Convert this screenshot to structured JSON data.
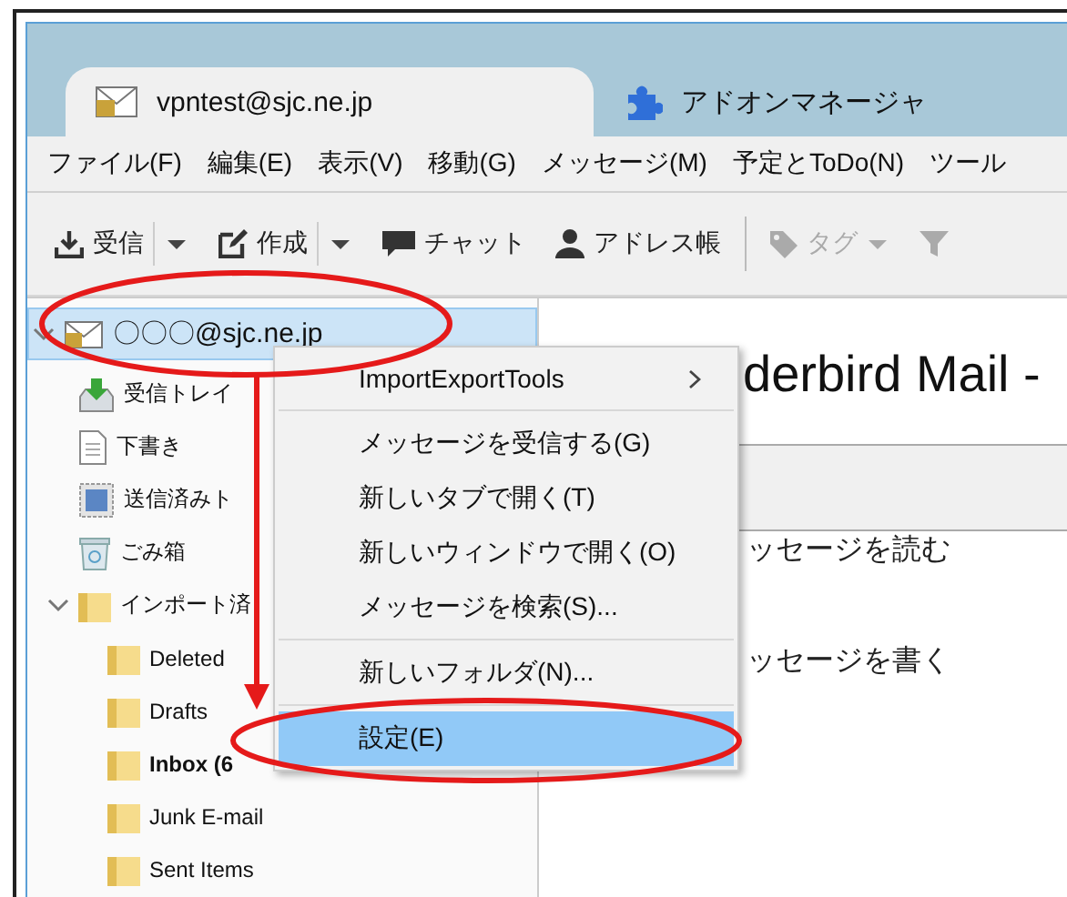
{
  "tabs": [
    {
      "label": "vpntest@sjc.ne.jp",
      "selected": true
    },
    {
      "label": "アドオンマネージャ",
      "selected": false
    }
  ],
  "menubar": [
    "ファイル(F)",
    "編集(E)",
    "表示(V)",
    "移動(G)",
    "メッセージ(M)",
    "予定とToDo(N)",
    "ツール"
  ],
  "toolbar": [
    {
      "kind": "button",
      "label": "受信",
      "dropdown": true,
      "disabled": false
    },
    {
      "kind": "button",
      "label": "作成",
      "dropdown": true,
      "disabled": false
    },
    {
      "kind": "button",
      "label": "チャット",
      "dropdown": false,
      "disabled": false
    },
    {
      "kind": "button",
      "label": "アドレス帳",
      "dropdown": false,
      "disabled": false
    },
    {
      "kind": "separator"
    },
    {
      "kind": "button",
      "label": "タグ",
      "dropdown": true,
      "disabled": true
    },
    {
      "kind": "button",
      "dropdown": false,
      "disabled": true
    }
  ],
  "folders": [
    {
      "name": "〇〇〇@sjc.ne.jp",
      "kind": "account",
      "selected": true,
      "expanded": true,
      "children": [
        {
          "name": "受信トレイ",
          "kind": "inbox",
          "selected": false
        },
        {
          "name": "下書き",
          "kind": "draft",
          "selected": false
        },
        {
          "name": "送信済みト",
          "kind": "sent",
          "selected": false
        },
        {
          "name": "ごみ箱",
          "kind": "trash",
          "selected": false
        },
        {
          "name": "インポート済",
          "kind": "folder",
          "selected": false,
          "expanded": true,
          "children": [
            {
              "name": "Deleted",
              "kind": "folder",
              "selected": false,
              "bold": false
            },
            {
              "name": "Drafts",
              "kind": "folder",
              "selected": false,
              "bold": false
            },
            {
              "name": "Inbox (6",
              "kind": "folder",
              "selected": false,
              "bold": true
            },
            {
              "name": "Junk E-mail",
              "kind": "folder",
              "selected": false,
              "bold": false
            },
            {
              "name": "Sent Items",
              "kind": "folder",
              "selected": false,
              "bold": false
            }
          ]
        }
      ]
    }
  ],
  "content": {
    "heading": "derbird Mail -",
    "links": [
      "ッセージを読む",
      "ッセージを書く"
    ]
  },
  "context_menu": [
    {
      "kind": "item",
      "label": "ImportExportTools",
      "submenu": true,
      "selected": false
    },
    {
      "kind": "separator"
    },
    {
      "kind": "item",
      "label": "メッセージを受信する(G)",
      "submenu": false,
      "selected": false
    },
    {
      "kind": "item",
      "label": "新しいタブで開く(T)",
      "submenu": false,
      "selected": false
    },
    {
      "kind": "item",
      "label": "新しいウィンドウで開く(O)",
      "submenu": false,
      "selected": false
    },
    {
      "kind": "item",
      "label": "メッセージを検索(S)...",
      "submenu": false,
      "selected": false
    },
    {
      "kind": "separator"
    },
    {
      "kind": "item",
      "label": "新しいフォルダ(N)...",
      "submenu": false,
      "selected": false
    },
    {
      "kind": "separator"
    },
    {
      "kind": "item",
      "label": "設定(E)",
      "submenu": false,
      "selected": true
    }
  ],
  "annotations": [
    {
      "kind": "ellipse"
    },
    {
      "kind": "arrow"
    },
    {
      "kind": "ellipse"
    }
  ]
}
